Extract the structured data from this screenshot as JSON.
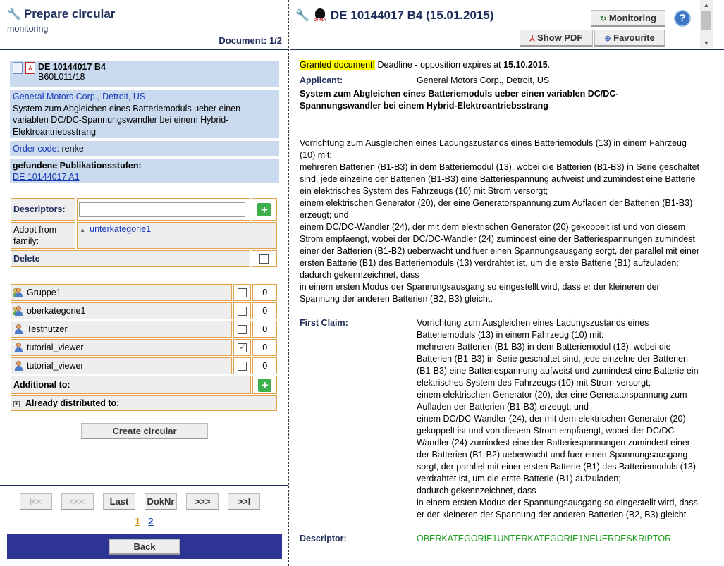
{
  "left": {
    "title": "Prepare circular",
    "subtitle": "monitoring",
    "document_counter": "Document: 1/2",
    "doc": {
      "number": "DE 10144017 B4",
      "classification": "B60L011/18",
      "applicant": "General Motors Corp., Detroit, US",
      "title": "System zum Abgleichen eines Batteriemoduls ueber einen variablen DC/DC-Spannungswandler bei einem Hybrid-Elektroantriebsstrang",
      "order_code_label": "Order code:",
      "order_code_value": "renke",
      "publications_label": "gefundene Publikationsstufen:",
      "publication_link": "DE 10144017 A1"
    },
    "form": {
      "descriptors_label": "Descriptors:",
      "descriptors_value": "",
      "adopt_label": "Adopt from family:",
      "adopt_item": "unterkategorie1",
      "delete_label": "Delete"
    },
    "recipients": [
      {
        "name": "Gruppe1",
        "type": "group",
        "checked": false,
        "count": "0"
      },
      {
        "name": "oberkategorie1",
        "type": "group",
        "checked": false,
        "count": "0"
      },
      {
        "name": "Testnutzer",
        "type": "user",
        "checked": false,
        "count": "0"
      },
      {
        "name": "tutorial_viewer",
        "type": "user",
        "checked": true,
        "count": "0"
      },
      {
        "name": "tutorial_viewer",
        "type": "user",
        "checked": false,
        "count": "0"
      }
    ],
    "additional_label": "Additional to:",
    "distributed_label": "Already distributed to:",
    "create_button": "Create circular",
    "nav": {
      "first": "I<<",
      "prev": "<<<",
      "last": "Last",
      "doknr": "DokNr",
      "next": ">>>",
      "end": ">>I"
    },
    "pager": {
      "sep": "-",
      "page1": "1",
      "page2": "2"
    },
    "back_button": "Back"
  },
  "right": {
    "title": "DE 10144017 B4 (15.01.2015)",
    "eagle_text": "DPMA",
    "monitoring_button": "Monitoring",
    "show_pdf_button": "Show PDF",
    "favourite_button": "Favourite",
    "help": "?",
    "status": {
      "granted": "Granted document!",
      "deadline_text": "Deadline - opposition expires at",
      "deadline_date": "15.10.2015",
      "period": "."
    },
    "applicant_label": "Applicant:",
    "applicant_value": "General Motors Corp., Detroit, US",
    "doc_title": "System zum Abgleichen eines Batteriemoduls ueber einen variablen DC/DC-Spannungswandler bei einem Hybrid-Elektroantriebsstrang",
    "abstract": [
      "Vorrichtung zum Ausgleichen eines Ladungszustands eines Batteriemoduls (13) in einem Fahrzeug (10) mit:",
      "mehreren Batterien (B1-B3) in dem Batteriemodul (13), wobei die Batterien (B1-B3) in Serie geschaltet sind, jede einzelne der Batterien (B1-B3) eine Batteriespannung aufweist und zumindest eine Batterie ein elektrisches System des Fahrzeugs (10) mit Strom versorgt;",
      "einem elektrischen Generator (20), der eine Generatorspannung zum Aufladen der Batterien (B1-B3) erzeugt; und",
      "einem DC/DC-Wandler (24), der mit dem elektrischen Generator (20) gekoppelt ist und von diesem Strom empfaengt, wobei der DC/DC-Wandler (24) zumindest eine der Batteriespannungen zumindest einer der Batterien (B1-B2) ueberwacht und fuer einen Spannungsausgang sorgt, der parallel mit einer ersten Batterie (B1) des Batteriemoduls (13) verdrahtet ist, um die erste Batterie (B1) aufzuladen;",
      "dadurch gekennzeichnet, dass",
      "in einem ersten Modus der Spannungsausgang so eingestellt wird, dass er der kleineren der Spannung der anderen Batterien (B2, B3) gleicht."
    ],
    "first_claim_label": "First Claim:",
    "first_claim": [
      "Vorrichtung zum Ausgleichen eines Ladungszustands eines Batteriemoduls (13) in einem Fahrzeug (10) mit:",
      "mehreren Batterien (B1-B3) in dem Batteriemodul (13), wobei die Batterien (B1-B3) in Serie geschaltet sind, jede einzelne der Batterien (B1-B3) eine Batteriespannung aufweist und zumindest eine Batterie ein elektrisches System des Fahrzeugs (10) mit Strom versorgt;",
      "einem elektrischen Generator (20), der eine Generatorspannung zum Aufladen der Batterien (B1-B3) erzeugt; und",
      "einem DC/DC-Wandler (24), der mit dem elektrischen Generator (20) gekoppelt ist und von diesem Strom empfaengt, wobei der DC/DC-Wandler (24) zumindest eine der Batteriespannungen zumindest einer der Batterien (B1-B2) ueberwacht und fuer einen Spannungsausgang sorgt, der parallel mit einer ersten Batterie (B1) des Batteriemoduls (13) verdrahtet ist, um die erste Batterie (B1) aufzuladen;",
      "dadurch gekennzeichnet, dass",
      "in einem ersten Modus der Spannungsausgang so eingestellt wird, dass er der kleineren der Spannung der anderen Batterien (B2, B3) gleicht."
    ],
    "descriptor_label": "Descriptor:",
    "descriptor_value": "OBERKATEGORIE1UNTERKATEGORIE1NEUERDESKRIPTOR"
  },
  "colors": {
    "title": "#1f2d5a",
    "link": "#1a3bb8",
    "info_bg": "#c9d9ee",
    "border_orange": "#e2a24a",
    "back_bar": "#2e3493",
    "highlight": "#ffff00",
    "green": "#1a9a1a"
  },
  "icons": [
    "wrench-icon",
    "document-icon",
    "pdf-icon",
    "plus-icon",
    "user-icon",
    "group-icon",
    "eagle-icon",
    "help-icon",
    "star-icon",
    "monitoring-icon"
  ]
}
